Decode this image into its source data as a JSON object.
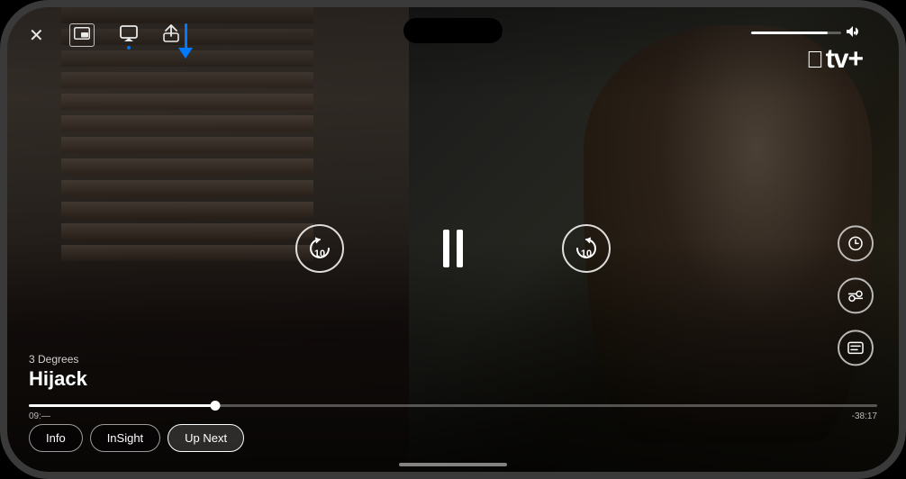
{
  "phone": {
    "frame_color": "#3a3a3a"
  },
  "app": {
    "name": "Apple TV+",
    "logo": "tv+"
  },
  "show": {
    "season_label": "3 Degrees",
    "title": "Hijack"
  },
  "controls": {
    "rewind_label": "10",
    "forward_label": "10",
    "pause_label": "Pause",
    "close_label": "✕"
  },
  "progress": {
    "elapsed": "09:—",
    "remaining": "-38:17",
    "percent": 22
  },
  "tabs": [
    {
      "id": "info",
      "label": "Info"
    },
    {
      "id": "insight",
      "label": "InSight"
    },
    {
      "id": "up-next",
      "label": "Up Next"
    }
  ],
  "top_icons": [
    {
      "id": "close",
      "symbol": "✕"
    },
    {
      "id": "pip",
      "symbol": "⊡"
    },
    {
      "id": "airplay",
      "symbol": "⬛"
    },
    {
      "id": "share",
      "symbol": "↑"
    }
  ],
  "right_icons": [
    {
      "id": "speed",
      "symbol": "◉"
    },
    {
      "id": "audio",
      "symbol": "≋"
    },
    {
      "id": "subtitle",
      "symbol": "💬"
    }
  ],
  "volume": {
    "level": 85
  },
  "blue_arrow": {
    "pointing_at": "airplay-button"
  }
}
